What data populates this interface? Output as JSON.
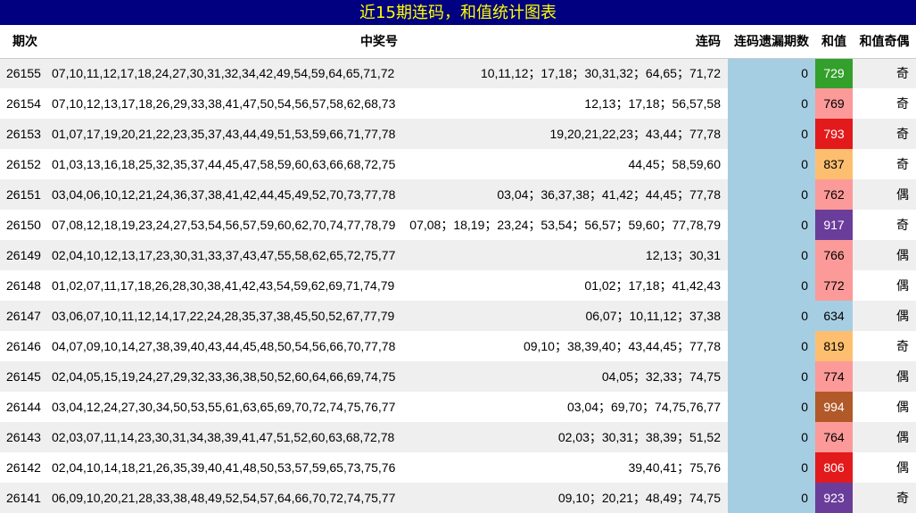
{
  "title": "近15期连码，和值统计图表",
  "headers": {
    "issue": "期次",
    "numbers": "中奖号",
    "consecutive": "连码",
    "miss": "连码遗漏期数",
    "sum": "和值",
    "odd_even": "和值奇偶"
  },
  "colors": {
    "title_bg": "#000080",
    "title_text": "#ffff00",
    "miss_bg": "#a6cee3",
    "row_alt_bg": "#efefef"
  },
  "rows": [
    {
      "issue": "26155",
      "numbers": "07,10,11,12,17,18,24,27,30,31,32,34,42,49,54,59,64,65,71,72",
      "consecutive": "10,11,12；17,18；30,31,32；64,65；71,72",
      "miss": "0",
      "sum": "729",
      "sum_color": "#33a02c",
      "sum_text_color": "#ffffff",
      "odd_even": "奇"
    },
    {
      "issue": "26154",
      "numbers": "07,10,12,13,17,18,26,29,33,38,41,47,50,54,56,57,58,62,68,73",
      "consecutive": "12,13；17,18；56,57,58",
      "miss": "0",
      "sum": "769",
      "sum_color": "#fb9a99",
      "sum_text_color": "#000000",
      "odd_even": "奇"
    },
    {
      "issue": "26153",
      "numbers": "01,07,17,19,20,21,22,23,35,37,43,44,49,51,53,59,66,71,77,78",
      "consecutive": "19,20,21,22,23；43,44；77,78",
      "miss": "0",
      "sum": "793",
      "sum_color": "#e31a1c",
      "sum_text_color": "#ffffff",
      "odd_even": "奇"
    },
    {
      "issue": "26152",
      "numbers": "01,03,13,16,18,25,32,35,37,44,45,47,58,59,60,63,66,68,72,75",
      "consecutive": "44,45；58,59,60",
      "miss": "0",
      "sum": "837",
      "sum_color": "#fdbf6f",
      "sum_text_color": "#000000",
      "odd_even": "奇"
    },
    {
      "issue": "26151",
      "numbers": "03,04,06,10,12,21,24,36,37,38,41,42,44,45,49,52,70,73,77,78",
      "consecutive": "03,04；36,37,38；41,42；44,45；77,78",
      "miss": "0",
      "sum": "762",
      "sum_color": "#fb9a99",
      "sum_text_color": "#000000",
      "odd_even": "偶"
    },
    {
      "issue": "26150",
      "numbers": "07,08,12,18,19,23,24,27,53,54,56,57,59,60,62,70,74,77,78,79",
      "consecutive": "07,08；18,19；23,24；53,54；56,57；59,60；77,78,79",
      "miss": "0",
      "sum": "917",
      "sum_color": "#6a3d9a",
      "sum_text_color": "#ffffff",
      "odd_even": "奇"
    },
    {
      "issue": "26149",
      "numbers": "02,04,10,12,13,17,23,30,31,33,37,43,47,55,58,62,65,72,75,77",
      "consecutive": "12,13；30,31",
      "miss": "0",
      "sum": "766",
      "sum_color": "#fb9a99",
      "sum_text_color": "#000000",
      "odd_even": "偶"
    },
    {
      "issue": "26148",
      "numbers": "01,02,07,11,17,18,26,28,30,38,41,42,43,54,59,62,69,71,74,79",
      "consecutive": "01,02；17,18；41,42,43",
      "miss": "0",
      "sum": "772",
      "sum_color": "#fb9a99",
      "sum_text_color": "#000000",
      "odd_even": "偶"
    },
    {
      "issue": "26147",
      "numbers": "03,06,07,10,11,12,14,17,22,24,28,35,37,38,45,50,52,67,77,79",
      "consecutive": "06,07；10,11,12；37,38",
      "miss": "0",
      "sum": "634",
      "sum_color": "#a6cee3",
      "sum_text_color": "#000000",
      "odd_even": "偶"
    },
    {
      "issue": "26146",
      "numbers": "04,07,09,10,14,27,38,39,40,43,44,45,48,50,54,56,66,70,77,78",
      "consecutive": "09,10；38,39,40；43,44,45；77,78",
      "miss": "0",
      "sum": "819",
      "sum_color": "#fdbf6f",
      "sum_text_color": "#000000",
      "odd_even": "奇"
    },
    {
      "issue": "26145",
      "numbers": "02,04,05,15,19,24,27,29,32,33,36,38,50,52,60,64,66,69,74,75",
      "consecutive": "04,05；32,33；74,75",
      "miss": "0",
      "sum": "774",
      "sum_color": "#fb9a99",
      "sum_text_color": "#000000",
      "odd_even": "偶"
    },
    {
      "issue": "26144",
      "numbers": "03,04,12,24,27,30,34,50,53,55,61,63,65,69,70,72,74,75,76,77",
      "consecutive": "03,04；69,70；74,75,76,77",
      "miss": "0",
      "sum": "994",
      "sum_color": "#b15928",
      "sum_text_color": "#ffffff",
      "odd_even": "偶"
    },
    {
      "issue": "26143",
      "numbers": "02,03,07,11,14,23,30,31,34,38,39,41,47,51,52,60,63,68,72,78",
      "consecutive": "02,03；30,31；38,39；51,52",
      "miss": "0",
      "sum": "764",
      "sum_color": "#fb9a99",
      "sum_text_color": "#000000",
      "odd_even": "偶"
    },
    {
      "issue": "26142",
      "numbers": "02,04,10,14,18,21,26,35,39,40,41,48,50,53,57,59,65,73,75,76",
      "consecutive": "39,40,41；75,76",
      "miss": "0",
      "sum": "806",
      "sum_color": "#e31a1c",
      "sum_text_color": "#ffffff",
      "odd_even": "偶"
    },
    {
      "issue": "26141",
      "numbers": "06,09,10,20,21,28,33,38,48,49,52,54,57,64,66,70,72,74,75,77",
      "consecutive": "09,10；20,21；48,49；74,75",
      "miss": "0",
      "sum": "923",
      "sum_color": "#6a3d9a",
      "sum_text_color": "#ffffff",
      "odd_even": "奇"
    }
  ]
}
